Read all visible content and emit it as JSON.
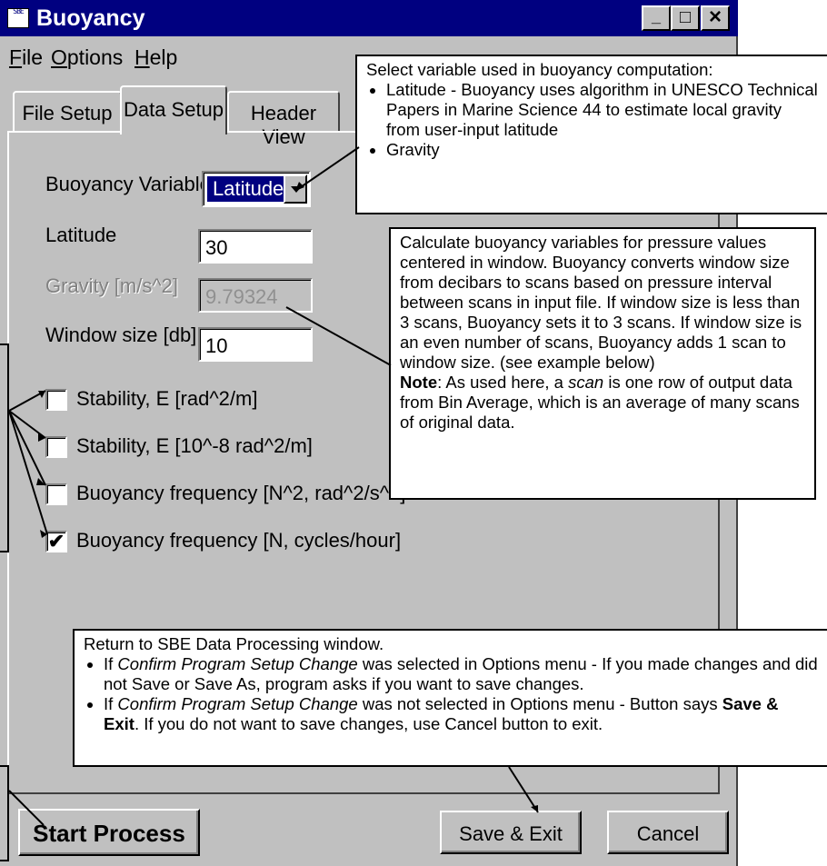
{
  "window": {
    "title": "Buoyancy",
    "app_icon_text": "SBE",
    "controls": {
      "minimize": "_",
      "maximize": "□",
      "close": "×"
    }
  },
  "menu": [
    {
      "mnemonic": "F",
      "rest": "ile"
    },
    {
      "mnemonic": "O",
      "rest": "ptions"
    },
    {
      "mnemonic": "H",
      "rest": "elp"
    }
  ],
  "tabs": [
    "File Setup",
    "Data Setup",
    "Header View"
  ],
  "active_tab": "Data Setup",
  "form": {
    "buoyancy_variable_label": "Buoyancy Variable",
    "buoyancy_variable_value": "Latitude",
    "latitude_label": "Latitude",
    "latitude_value": "30",
    "gravity_label": "Gravity [m/s^2]",
    "gravity_value": "9.79324",
    "window_size_label": "Window size [db]",
    "window_size_value": "10"
  },
  "checkboxes": [
    {
      "label": "Stability, E [rad^2/m]",
      "checked": false,
      "mark": ""
    },
    {
      "label": "Stability, E [10^-8 rad^2/m]",
      "checked": false,
      "mark": ""
    },
    {
      "label": "Buoyancy frequency [N^2, rad^2/s^2]",
      "checked": false,
      "mark": ""
    },
    {
      "label": "Buoyancy frequency [N, cycles/hour]",
      "checked": true,
      "mark": "✔"
    }
  ],
  "buttons": {
    "start_process": "Start Process",
    "save_exit": "Save & Exit",
    "cancel": "Cancel"
  },
  "callouts": {
    "variable": {
      "intro": "Select variable used in buoyancy computation:",
      "items": [
        "Latitude - Buoyancy uses algorithm in UNESCO Technical Papers in Marine Science 44 to estimate local gravity from user-input latitude",
        "Gravity"
      ]
    },
    "window_size": {
      "text": "Calculate buoyancy variables for pressure values centered in window. Buoyancy converts window size from decibars to scans based on pressure interval between scans in input file. If window size is less than 3 scans, Buoyancy sets it to 3 scans. If window size is an even number of scans, Buoyancy adds 1 scan to window size. (see example below)",
      "note_label": "Note",
      "note_1": ": As used here, a ",
      "note_italic": "scan",
      "note_2": " is one row of output data from Bin Average, which is an average of many scans of original data."
    },
    "save_exit": {
      "intro": "Return to SBE Data Processing window.",
      "item1_a": "If ",
      "item1_italic": "Confirm Program Setup Change",
      "item1_b": " was selected in Options menu - If you made changes and did not Save or Save As, program asks if you want to save changes.",
      "item2_a": "If ",
      "item2_italic": "Confirm Program Setup Change",
      "item2_b": " was not selected in Options menu - Button says ",
      "item2_bold": "Save & Exit",
      "item2_c": ". If you do not want to save changes, use Cancel button to exit."
    }
  }
}
